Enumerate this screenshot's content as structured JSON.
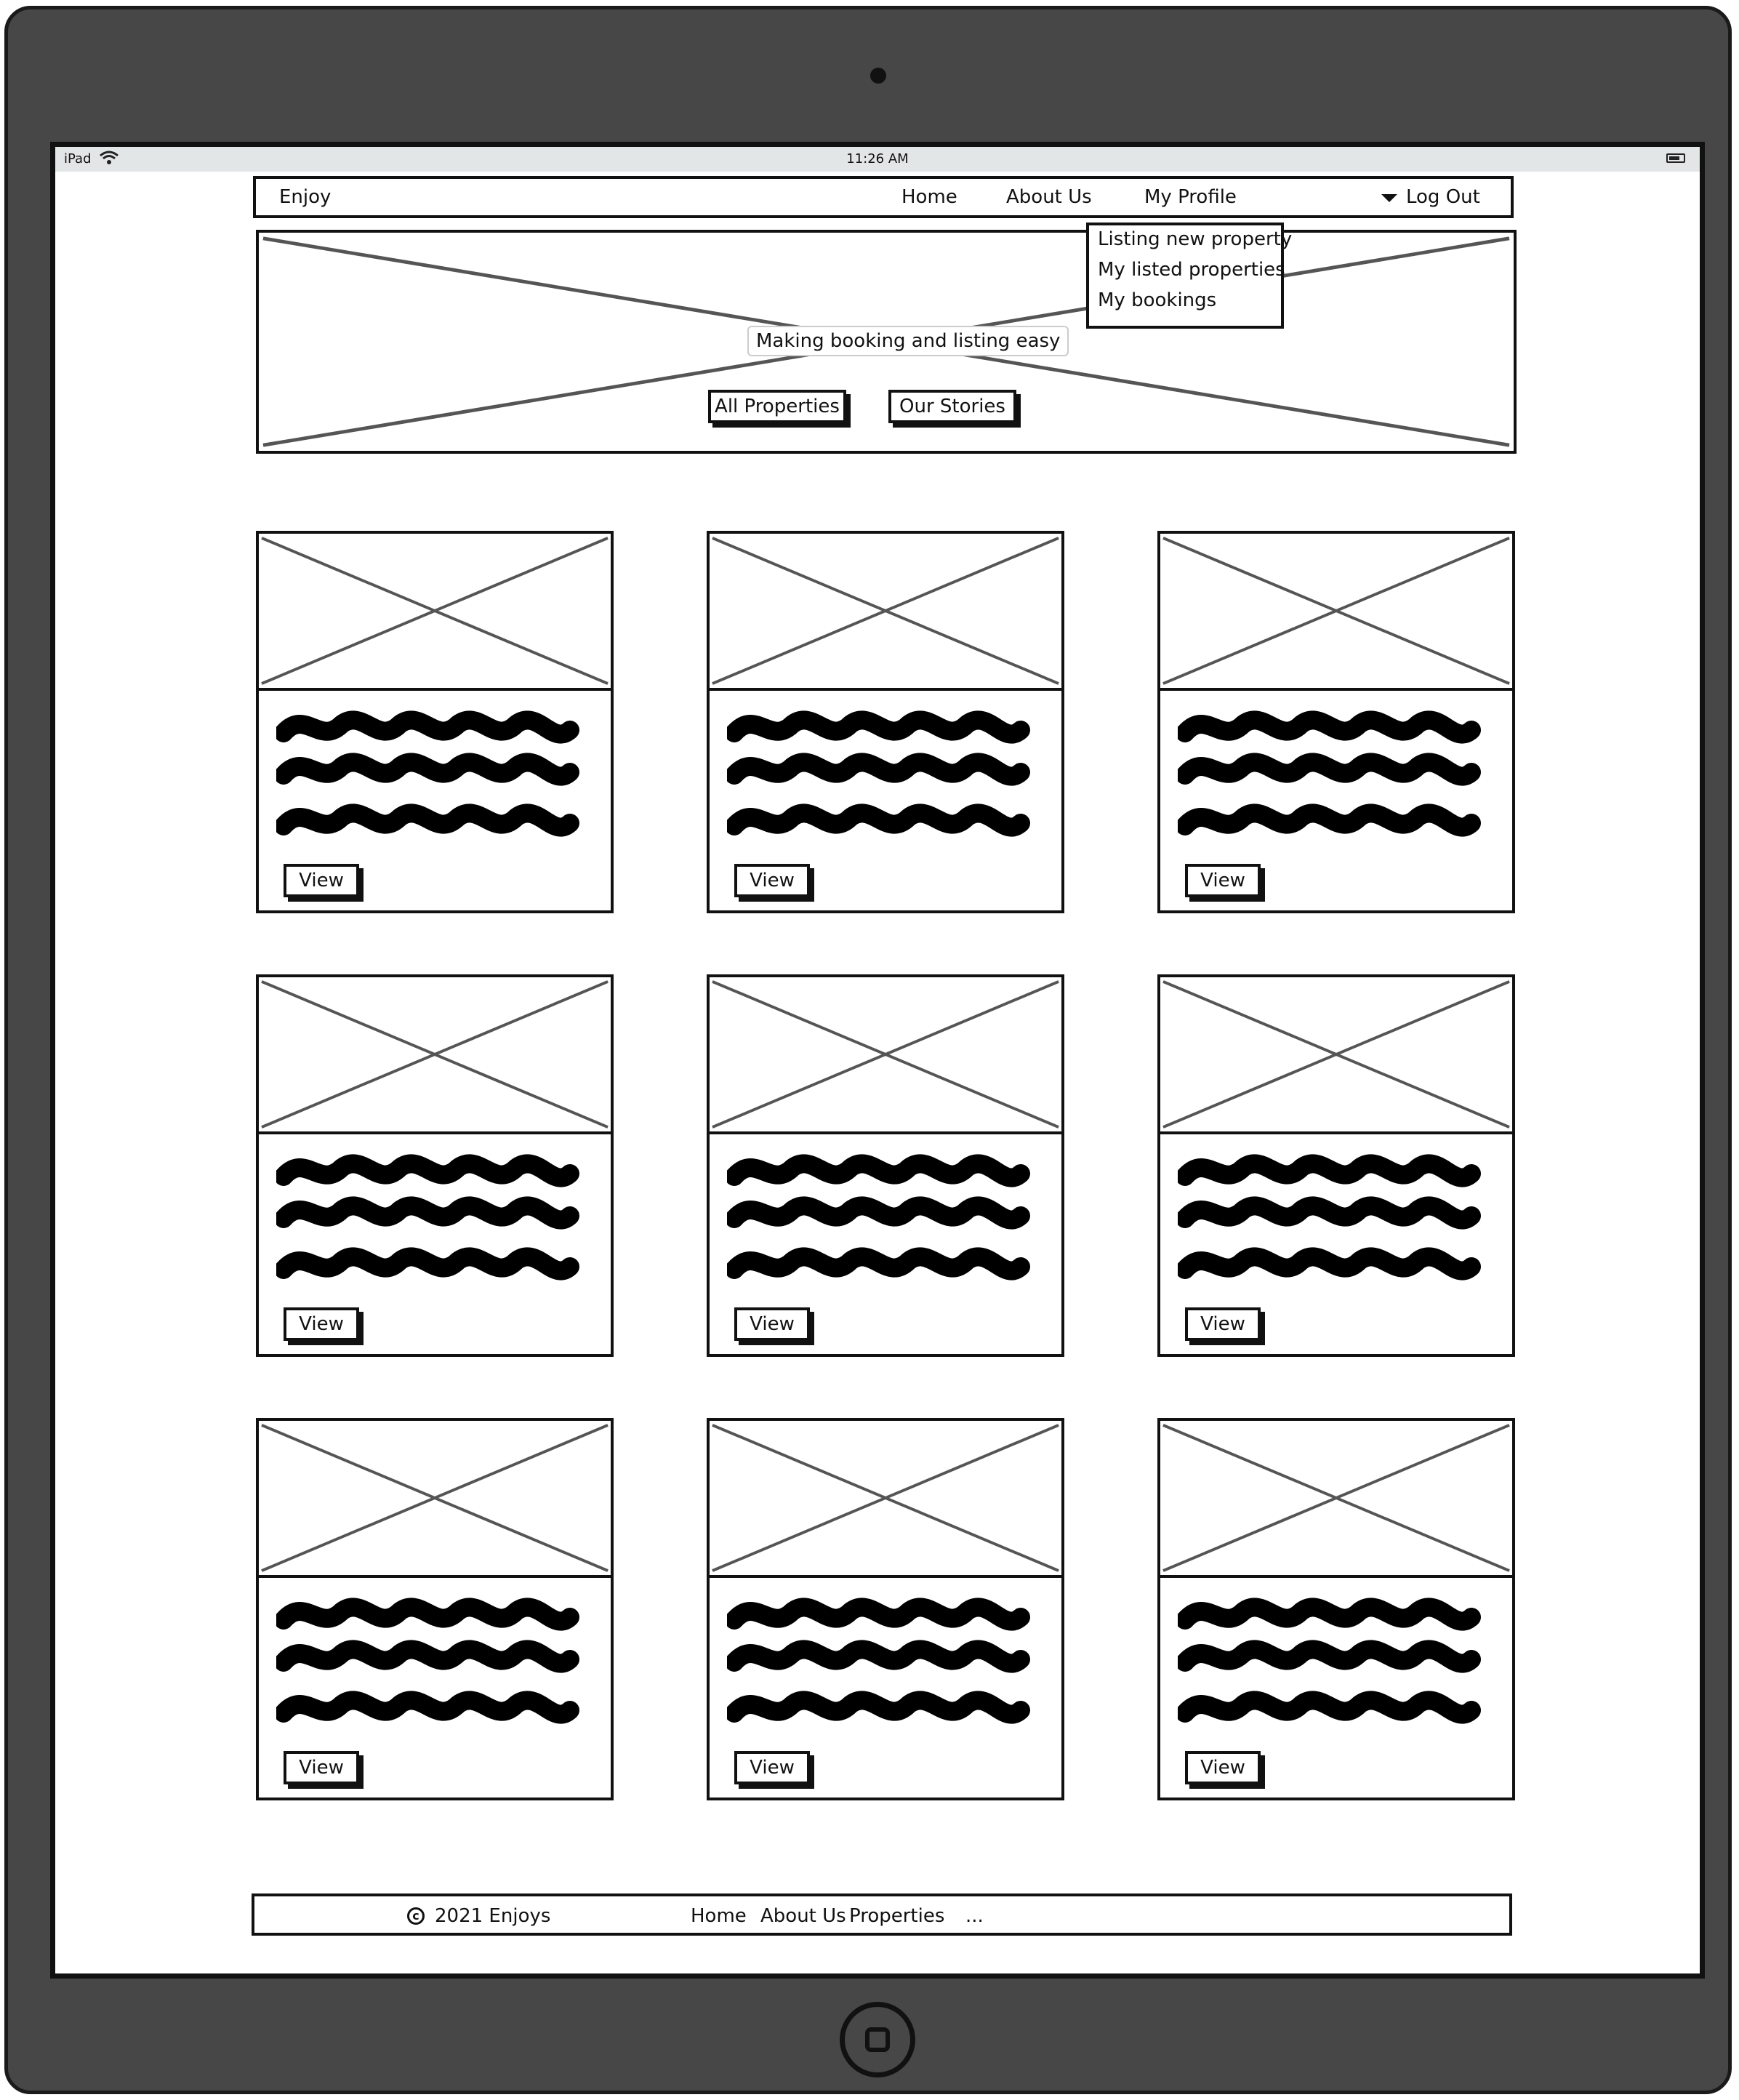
{
  "status_bar": {
    "carrier": "iPad",
    "time": "11:26 AM"
  },
  "navbar": {
    "brand": "Enjoy",
    "links": [
      "Home",
      "About Us",
      "My Profile",
      "Log Out"
    ]
  },
  "dropdown": {
    "items": [
      "Listing new property",
      "My listed properties",
      "My bookings"
    ]
  },
  "hero": {
    "caption": "Making booking and listing easy",
    "buttons": [
      "All Properties",
      "Our Stories"
    ]
  },
  "cards": [
    {
      "button": "View"
    },
    {
      "button": "View"
    },
    {
      "button": "View"
    },
    {
      "button": "View"
    },
    {
      "button": "View"
    },
    {
      "button": "View"
    },
    {
      "button": "View"
    },
    {
      "button": "View"
    },
    {
      "button": "View"
    }
  ],
  "footer": {
    "copyright": "2021 Enjoys",
    "links": [
      "Home",
      "About Us",
      "Properties"
    ],
    "ellipsis": "..."
  }
}
